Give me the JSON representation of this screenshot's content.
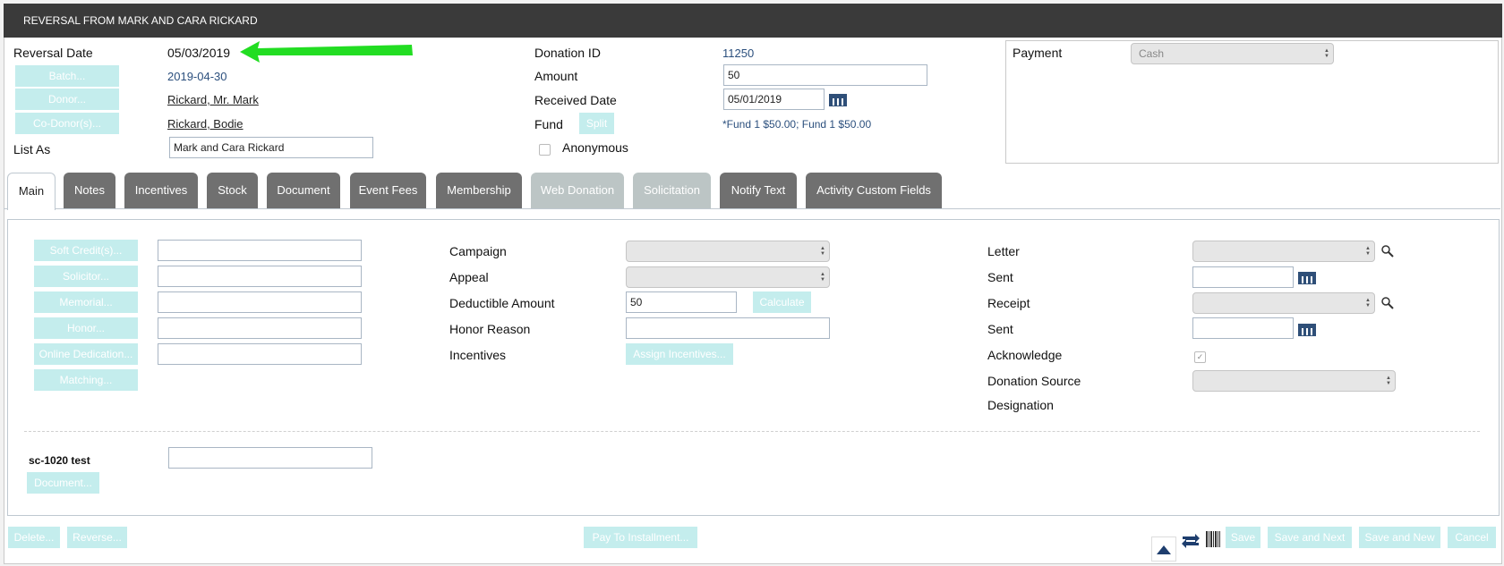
{
  "window": {
    "title": "REVERSAL FROM MARK AND CARA RICKARD"
  },
  "header": {
    "reversal_date_label": "Reversal Date",
    "reversal_date_value": "05/03/2019",
    "batch_button": "Batch...",
    "batch_value": "2019-04-30",
    "donor_button": "Donor...",
    "donor_value": "Rickard, Mr. Mark",
    "codonor_button": "Co-Donor(s)...",
    "codonor_value": "Rickard, Bodie",
    "list_as_label": "List As",
    "list_as_value": "Mark and Cara Rickard",
    "donation_id_label": "Donation ID",
    "donation_id_value": "11250",
    "amount_label": "Amount",
    "amount_value": "50",
    "received_date_label": "Received Date",
    "received_date_value": "05/01/2019",
    "fund_label": "Fund",
    "split_button": "Split",
    "fund_value": "*Fund 1 $50.00; Fund 1 $50.00",
    "anonymous_label": "Anonymous",
    "payment_label": "Payment",
    "payment_value": "Cash",
    "arrow_color": "#22dd22"
  },
  "tabs": [
    {
      "label": "Main",
      "state": "active"
    },
    {
      "label": "Notes",
      "state": "normal"
    },
    {
      "label": "Incentives",
      "state": "normal"
    },
    {
      "label": "Stock",
      "state": "normal"
    },
    {
      "label": "Document",
      "state": "normal"
    },
    {
      "label": "Event Fees",
      "state": "normal"
    },
    {
      "label": "Membership",
      "state": "normal"
    },
    {
      "label": "Web Donation",
      "state": "disabled"
    },
    {
      "label": "Solicitation",
      "state": "disabled"
    },
    {
      "label": "Notify Text",
      "state": "normal"
    },
    {
      "label": "Activity Custom Fields",
      "state": "normal"
    }
  ],
  "main": {
    "left_buttons": [
      "Soft Credit(s)...",
      "Solicitor...",
      "Memorial...",
      "Honor...",
      "Online Dedication...",
      "Matching..."
    ],
    "campaign_label": "Campaign",
    "appeal_label": "Appeal",
    "deductible_label": "Deductible Amount",
    "deductible_value": "50",
    "calculate_button": "Calculate",
    "honor_reason_label": "Honor Reason",
    "incentives_label": "Incentives",
    "assign_incentives_button": "Assign Incentives...",
    "letter_label": "Letter",
    "letter_sent_label": "Sent",
    "receipt_label": "Receipt",
    "receipt_sent_label": "Sent",
    "acknowledge_label": "Acknowledge",
    "donation_source_label": "Donation Source",
    "designation_label": "Designation",
    "custom_label": "sc-1020 test",
    "document_button": "Document..."
  },
  "footer": {
    "delete_button": "Delete...",
    "reverse_button": "Reverse...",
    "pay_installment_button": "Pay To Installment...",
    "save_button": "Save",
    "save_next_button": "Save and Next",
    "save_new_button": "Save and New",
    "cancel_button": "Cancel"
  },
  "colors": {
    "titlebar": "#3a3a3a",
    "button_disabled": "#c4eded",
    "link": "#2b4f7d",
    "tab": "#707070"
  }
}
